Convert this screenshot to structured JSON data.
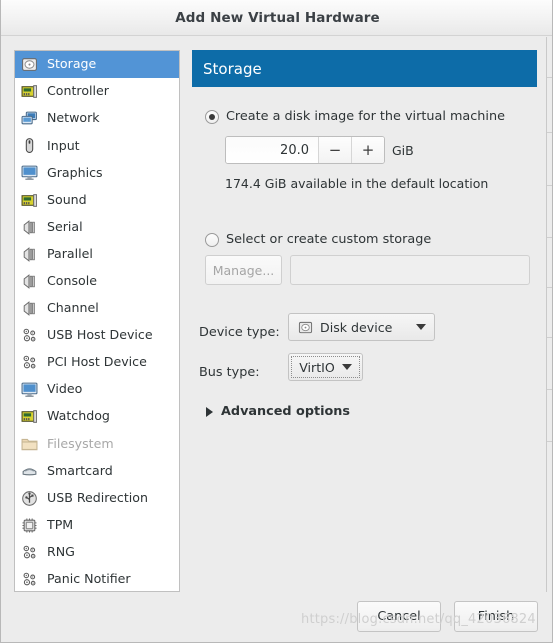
{
  "window": {
    "title": "Add New Virtual Hardware"
  },
  "sidebar": {
    "items": [
      {
        "label": "Storage",
        "icon": "disk-icon",
        "selected": true,
        "disabled": false
      },
      {
        "label": "Controller",
        "icon": "card-icon",
        "selected": false,
        "disabled": false
      },
      {
        "label": "Network",
        "icon": "network-icon",
        "selected": false,
        "disabled": false
      },
      {
        "label": "Input",
        "icon": "mouse-icon",
        "selected": false,
        "disabled": false
      },
      {
        "label": "Graphics",
        "icon": "monitor-icon",
        "selected": false,
        "disabled": false
      },
      {
        "label": "Sound",
        "icon": "card-icon",
        "selected": false,
        "disabled": false
      },
      {
        "label": "Serial",
        "icon": "port-icon",
        "selected": false,
        "disabled": false
      },
      {
        "label": "Parallel",
        "icon": "port-icon",
        "selected": false,
        "disabled": false
      },
      {
        "label": "Console",
        "icon": "port-icon",
        "selected": false,
        "disabled": false
      },
      {
        "label": "Channel",
        "icon": "port-icon",
        "selected": false,
        "disabled": false
      },
      {
        "label": "USB Host Device",
        "icon": "chip-cluster-icon",
        "selected": false,
        "disabled": false
      },
      {
        "label": "PCI Host Device",
        "icon": "chip-cluster-icon",
        "selected": false,
        "disabled": false
      },
      {
        "label": "Video",
        "icon": "monitor-icon",
        "selected": false,
        "disabled": false
      },
      {
        "label": "Watchdog",
        "icon": "card-icon",
        "selected": false,
        "disabled": false
      },
      {
        "label": "Filesystem",
        "icon": "folder-icon",
        "selected": false,
        "disabled": true
      },
      {
        "label": "Smartcard",
        "icon": "smartcard-icon",
        "selected": false,
        "disabled": false
      },
      {
        "label": "USB Redirection",
        "icon": "usb-icon",
        "selected": false,
        "disabled": false
      },
      {
        "label": "TPM",
        "icon": "chip-icon",
        "selected": false,
        "disabled": false
      },
      {
        "label": "RNG",
        "icon": "chip-cluster-icon",
        "selected": false,
        "disabled": false
      },
      {
        "label": "Panic Notifier",
        "icon": "chip-cluster-icon",
        "selected": false,
        "disabled": false
      }
    ]
  },
  "panel": {
    "header_title": "Storage",
    "create_disk": {
      "radio_label": "Create a disk image for the virtual machine",
      "selected": true,
      "size_value": "20.0",
      "decrement_label": "−",
      "increment_label": "+",
      "size_units": "GiB",
      "availability_text": "174.4 GiB available in the default location"
    },
    "custom_storage": {
      "radio_label": "Select or create custom storage",
      "selected": false,
      "manage_button_label": "Manage...",
      "manage_button_disabled": true,
      "path_value": "",
      "path_placeholder": ""
    },
    "device_type": {
      "label": "Device type:",
      "value": "Disk device",
      "icon": "disk-icon"
    },
    "bus_type": {
      "label": "Bus type:",
      "value": "VirtIO"
    },
    "advanced_options": {
      "label": "Advanced options",
      "expanded": false,
      "icon": "triangle-right-icon"
    }
  },
  "footer": {
    "cancel_label": "Cancel",
    "finish_label": "Finish"
  },
  "watermark": {
    "text": "https://blog.csdn.net/qq_42036824"
  },
  "colors": {
    "header_blue": "#0d6ca8",
    "selection_blue": "#5294d6",
    "window_bg": "#ececec",
    "list_bg": "#ffffff"
  }
}
